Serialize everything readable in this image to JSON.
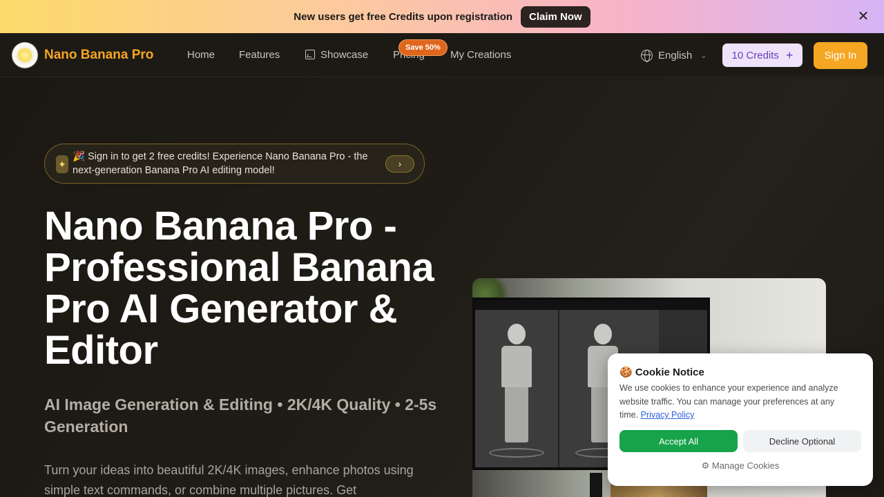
{
  "promo": {
    "text": "New users get free Credits upon registration",
    "cta": "Claim Now",
    "close": "✕"
  },
  "nav": {
    "brand": "Nano Banana Pro",
    "links": {
      "home": "Home",
      "features": "Features",
      "showcase": "Showcase",
      "pricing": "Pricing",
      "my_creations": "My Creations"
    },
    "save_badge": "Save 50%",
    "language": "English",
    "credits": "10 Credits",
    "sign_in": "Sign In"
  },
  "hero": {
    "announcement": "🎉 Sign in to get 2 free credits! Experience Nano Banana Pro - the next-generation Banana Pro AI editing model!",
    "title": "Nano Banana Pro - Professional Banana Pro AI Generator & Editor",
    "subtitle": "AI Image Generation & Editing • 2K/4K Quality • 2-5s Generation",
    "description": "Turn your ideas into beautiful 2K/4K images, enhance photos using simple text commands, or combine multiple pictures. Get"
  },
  "cookie": {
    "title": "🍪 Cookie Notice",
    "body": "We use cookies to enhance your experience and analyze website traffic. You can manage your preferences at any time.",
    "link": "Privacy Policy",
    "accept": "Accept All",
    "decline": "Decline Optional",
    "manage": "Manage Cookies"
  },
  "colors": {
    "accent": "#f5a623",
    "credits_bg": "#eee3fb",
    "accept_green": "#16a34a"
  },
  "icons": [
    "close-icon",
    "logo-icon",
    "showcase-icon",
    "globe-icon",
    "chevron-down-icon",
    "plus-icon",
    "sparkle-icon",
    "chevron-right-icon",
    "gear-icon"
  ]
}
